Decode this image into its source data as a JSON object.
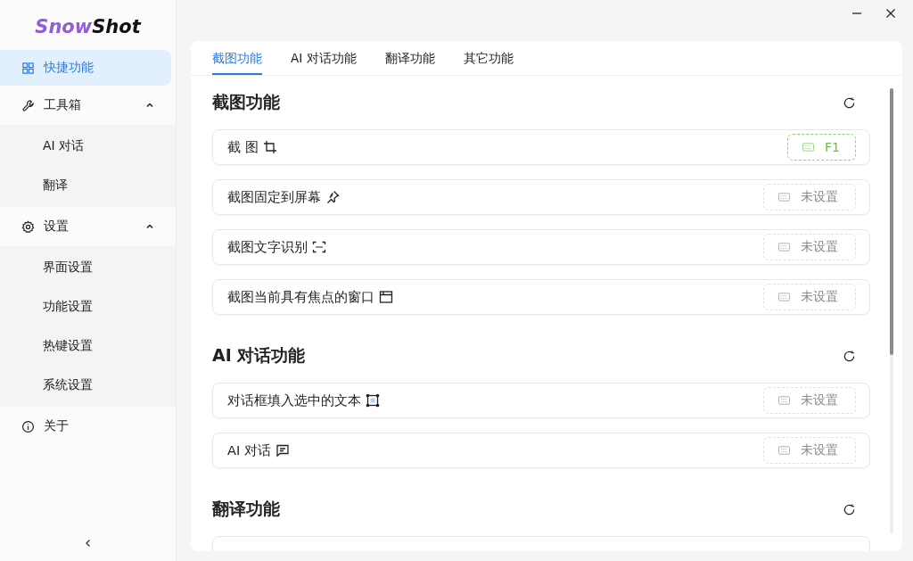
{
  "app": {
    "logo_first": "Snow",
    "logo_second": "Shot"
  },
  "sidebar": {
    "items": [
      {
        "label": "快捷功能",
        "selected": true
      },
      {
        "label": "工具箱",
        "selected": false,
        "expanded": true,
        "children": [
          {
            "label": "AI 对话",
            "selected": false
          },
          {
            "label": "翻译",
            "selected": false
          }
        ]
      },
      {
        "label": "设置",
        "selected": false,
        "expanded": true,
        "children": [
          {
            "label": "界面设置",
            "selected": false
          },
          {
            "label": "功能设置",
            "selected": false
          },
          {
            "label": "热键设置",
            "selected": false
          },
          {
            "label": "系统设置",
            "selected": false
          }
        ]
      },
      {
        "label": "关于",
        "selected": false
      }
    ]
  },
  "tabs": [
    {
      "label": "截图功能",
      "selected": true
    },
    {
      "label": "AI 对话功能",
      "selected": false
    },
    {
      "label": "翻译功能",
      "selected": false
    },
    {
      "label": "其它功能",
      "selected": false
    }
  ],
  "sections": [
    {
      "title": "截图功能",
      "rows": [
        {
          "label": "截 图",
          "hotkey": "F1",
          "set": true
        },
        {
          "label": "截图固定到屏幕",
          "hotkey": "未设置",
          "set": false
        },
        {
          "label": "截图文字识别",
          "hotkey": "未设置",
          "set": false
        },
        {
          "label": "截图当前具有焦点的窗口",
          "hotkey": "未设置",
          "set": false
        }
      ]
    },
    {
      "title": "AI 对话功能",
      "rows": [
        {
          "label": "对话框填入选中的文本",
          "hotkey": "未设置",
          "set": false
        },
        {
          "label": "AI 对话",
          "hotkey": "未设置",
          "set": false
        }
      ]
    },
    {
      "title": "翻译功能"
    }
  ]
}
